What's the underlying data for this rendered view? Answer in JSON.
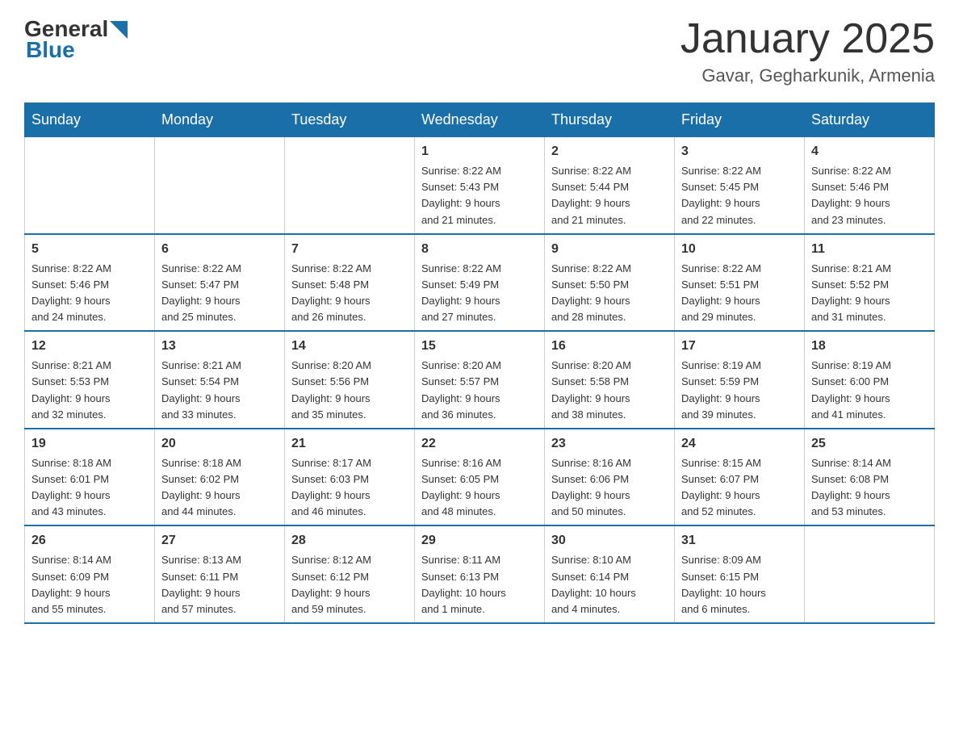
{
  "header": {
    "logo_general": "General",
    "logo_blue": "Blue",
    "month": "January 2025",
    "location": "Gavar, Gegharkunik, Armenia"
  },
  "days_of_week": [
    "Sunday",
    "Monday",
    "Tuesday",
    "Wednesday",
    "Thursday",
    "Friday",
    "Saturday"
  ],
  "weeks": [
    [
      {
        "day": "",
        "info": ""
      },
      {
        "day": "",
        "info": ""
      },
      {
        "day": "",
        "info": ""
      },
      {
        "day": "1",
        "info": "Sunrise: 8:22 AM\nSunset: 5:43 PM\nDaylight: 9 hours\nand 21 minutes."
      },
      {
        "day": "2",
        "info": "Sunrise: 8:22 AM\nSunset: 5:44 PM\nDaylight: 9 hours\nand 21 minutes."
      },
      {
        "day": "3",
        "info": "Sunrise: 8:22 AM\nSunset: 5:45 PM\nDaylight: 9 hours\nand 22 minutes."
      },
      {
        "day": "4",
        "info": "Sunrise: 8:22 AM\nSunset: 5:46 PM\nDaylight: 9 hours\nand 23 minutes."
      }
    ],
    [
      {
        "day": "5",
        "info": "Sunrise: 8:22 AM\nSunset: 5:46 PM\nDaylight: 9 hours\nand 24 minutes."
      },
      {
        "day": "6",
        "info": "Sunrise: 8:22 AM\nSunset: 5:47 PM\nDaylight: 9 hours\nand 25 minutes."
      },
      {
        "day": "7",
        "info": "Sunrise: 8:22 AM\nSunset: 5:48 PM\nDaylight: 9 hours\nand 26 minutes."
      },
      {
        "day": "8",
        "info": "Sunrise: 8:22 AM\nSunset: 5:49 PM\nDaylight: 9 hours\nand 27 minutes."
      },
      {
        "day": "9",
        "info": "Sunrise: 8:22 AM\nSunset: 5:50 PM\nDaylight: 9 hours\nand 28 minutes."
      },
      {
        "day": "10",
        "info": "Sunrise: 8:22 AM\nSunset: 5:51 PM\nDaylight: 9 hours\nand 29 minutes."
      },
      {
        "day": "11",
        "info": "Sunrise: 8:21 AM\nSunset: 5:52 PM\nDaylight: 9 hours\nand 31 minutes."
      }
    ],
    [
      {
        "day": "12",
        "info": "Sunrise: 8:21 AM\nSunset: 5:53 PM\nDaylight: 9 hours\nand 32 minutes."
      },
      {
        "day": "13",
        "info": "Sunrise: 8:21 AM\nSunset: 5:54 PM\nDaylight: 9 hours\nand 33 minutes."
      },
      {
        "day": "14",
        "info": "Sunrise: 8:20 AM\nSunset: 5:56 PM\nDaylight: 9 hours\nand 35 minutes."
      },
      {
        "day": "15",
        "info": "Sunrise: 8:20 AM\nSunset: 5:57 PM\nDaylight: 9 hours\nand 36 minutes."
      },
      {
        "day": "16",
        "info": "Sunrise: 8:20 AM\nSunset: 5:58 PM\nDaylight: 9 hours\nand 38 minutes."
      },
      {
        "day": "17",
        "info": "Sunrise: 8:19 AM\nSunset: 5:59 PM\nDaylight: 9 hours\nand 39 minutes."
      },
      {
        "day": "18",
        "info": "Sunrise: 8:19 AM\nSunset: 6:00 PM\nDaylight: 9 hours\nand 41 minutes."
      }
    ],
    [
      {
        "day": "19",
        "info": "Sunrise: 8:18 AM\nSunset: 6:01 PM\nDaylight: 9 hours\nand 43 minutes."
      },
      {
        "day": "20",
        "info": "Sunrise: 8:18 AM\nSunset: 6:02 PM\nDaylight: 9 hours\nand 44 minutes."
      },
      {
        "day": "21",
        "info": "Sunrise: 8:17 AM\nSunset: 6:03 PM\nDaylight: 9 hours\nand 46 minutes."
      },
      {
        "day": "22",
        "info": "Sunrise: 8:16 AM\nSunset: 6:05 PM\nDaylight: 9 hours\nand 48 minutes."
      },
      {
        "day": "23",
        "info": "Sunrise: 8:16 AM\nSunset: 6:06 PM\nDaylight: 9 hours\nand 50 minutes."
      },
      {
        "day": "24",
        "info": "Sunrise: 8:15 AM\nSunset: 6:07 PM\nDaylight: 9 hours\nand 52 minutes."
      },
      {
        "day": "25",
        "info": "Sunrise: 8:14 AM\nSunset: 6:08 PM\nDaylight: 9 hours\nand 53 minutes."
      }
    ],
    [
      {
        "day": "26",
        "info": "Sunrise: 8:14 AM\nSunset: 6:09 PM\nDaylight: 9 hours\nand 55 minutes."
      },
      {
        "day": "27",
        "info": "Sunrise: 8:13 AM\nSunset: 6:11 PM\nDaylight: 9 hours\nand 57 minutes."
      },
      {
        "day": "28",
        "info": "Sunrise: 8:12 AM\nSunset: 6:12 PM\nDaylight: 9 hours\nand 59 minutes."
      },
      {
        "day": "29",
        "info": "Sunrise: 8:11 AM\nSunset: 6:13 PM\nDaylight: 10 hours\nand 1 minute."
      },
      {
        "day": "30",
        "info": "Sunrise: 8:10 AM\nSunset: 6:14 PM\nDaylight: 10 hours\nand 4 minutes."
      },
      {
        "day": "31",
        "info": "Sunrise: 8:09 AM\nSunset: 6:15 PM\nDaylight: 10 hours\nand 6 minutes."
      },
      {
        "day": "",
        "info": ""
      }
    ]
  ]
}
